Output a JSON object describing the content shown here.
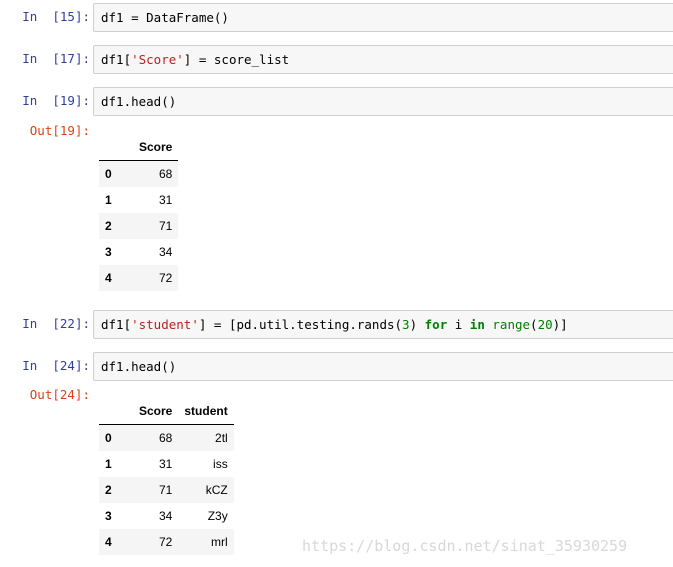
{
  "cells": [
    {
      "prompt": "In  [15]:",
      "code": "df1 = DataFrame()"
    },
    {
      "prompt": "In  [17]:",
      "code_pre": "df1[",
      "code_str": "'Score'",
      "code_post": "] = score_list"
    },
    {
      "prompt": "In  [19]:",
      "code": "df1.head()"
    },
    {
      "prompt": "In  [22]:",
      "code_pre": "df1[",
      "code_str": "'student'",
      "code_mid": "] = [pd.util.testing.rands(",
      "num1": "3",
      "code_c": ") ",
      "kw_for": "for",
      "code_i": " i ",
      "kw_in": "in",
      "code_sp": " ",
      "bi_range": "range",
      "code_p1": "(",
      "num2": "20",
      "code_end": ")]"
    },
    {
      "prompt": "In  [24]:",
      "code": "df1.head()"
    }
  ],
  "outputs": [
    {
      "prompt": "Out[19]:",
      "columns": [
        "Score"
      ],
      "rows": [
        {
          "index": "0",
          "values": [
            "68"
          ]
        },
        {
          "index": "1",
          "values": [
            "31"
          ]
        },
        {
          "index": "2",
          "values": [
            "71"
          ]
        },
        {
          "index": "3",
          "values": [
            "34"
          ]
        },
        {
          "index": "4",
          "values": [
            "72"
          ]
        }
      ]
    },
    {
      "prompt": "Out[24]:",
      "columns": [
        "Score",
        "student"
      ],
      "rows": [
        {
          "index": "0",
          "values": [
            "68",
            "2tl"
          ]
        },
        {
          "index": "1",
          "values": [
            "31",
            "iss"
          ]
        },
        {
          "index": "2",
          "values": [
            "71",
            "kCZ"
          ]
        },
        {
          "index": "3",
          "values": [
            "34",
            "Z3y"
          ]
        },
        {
          "index": "4",
          "values": [
            "72",
            "mrl"
          ]
        }
      ]
    }
  ],
  "watermark": "https://blog.csdn.net/sinat_35930259",
  "colors": {
    "in_prompt": "#303f9f",
    "out_prompt": "#d84315",
    "string": "#ba2121",
    "keyword": "#008000",
    "cell_bg": "#f7f7f7"
  }
}
